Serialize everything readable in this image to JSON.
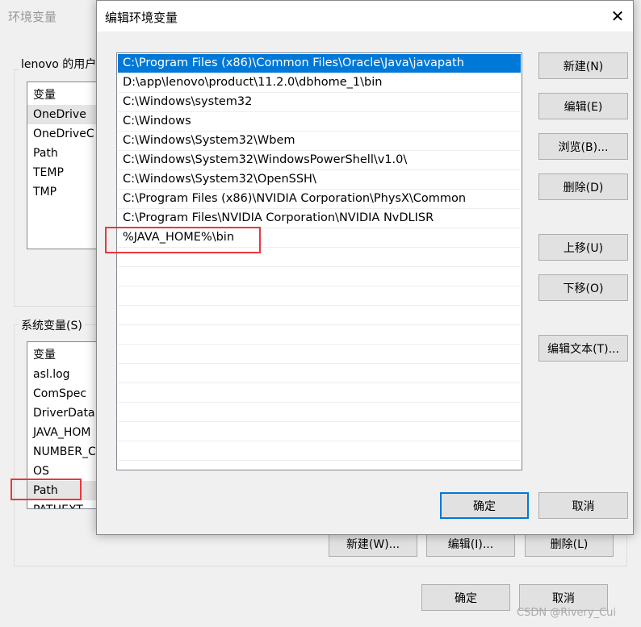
{
  "background_dialog": {
    "title": "环境变量",
    "user_group_label": "lenovo 的用户",
    "user_vars_header": "变量",
    "user_vars": [
      "OneDrive",
      "OneDriveC",
      "Path",
      "TEMP",
      "TMP"
    ],
    "system_group_label": "系统变量(S)",
    "system_vars_header": "变量",
    "system_vars": [
      "asl.log",
      "ComSpec",
      "DriverData",
      "JAVA_HOM",
      "NUMBER_C",
      "OS",
      "Path",
      "PATHEXT"
    ],
    "system_buttons": [
      "新建(W)...",
      "编辑(I)...",
      "删除(L)"
    ],
    "ok": "确定",
    "cancel": "取消"
  },
  "edit_dialog": {
    "title": "编辑环境变量",
    "close_icon": "close-icon",
    "paths": [
      "C:\\Program Files (x86)\\Common Files\\Oracle\\Java\\javapath",
      "D:\\app\\lenovo\\product\\11.2.0\\dbhome_1\\bin",
      "C:\\Windows\\system32",
      "C:\\Windows",
      "C:\\Windows\\System32\\Wbem",
      "C:\\Windows\\System32\\WindowsPowerShell\\v1.0\\",
      "C:\\Windows\\System32\\OpenSSH\\",
      "C:\\Program Files (x86)\\NVIDIA Corporation\\PhysX\\Common",
      "C:\\Program Files\\NVIDIA Corporation\\NVIDIA NvDLISR",
      "%JAVA_HOME%\\bin"
    ],
    "buttons": {
      "new": "新建(N)",
      "edit": "编辑(E)",
      "browse": "浏览(B)...",
      "delete": "删除(D)",
      "up": "上移(U)",
      "down": "下移(O)",
      "edit_text": "编辑文本(T)..."
    },
    "ok": "确定",
    "cancel": "取消",
    "selection_color": "#0078d7",
    "highlight_color": "#e8383d"
  },
  "watermark": "CSDN @Rivery_Cui"
}
